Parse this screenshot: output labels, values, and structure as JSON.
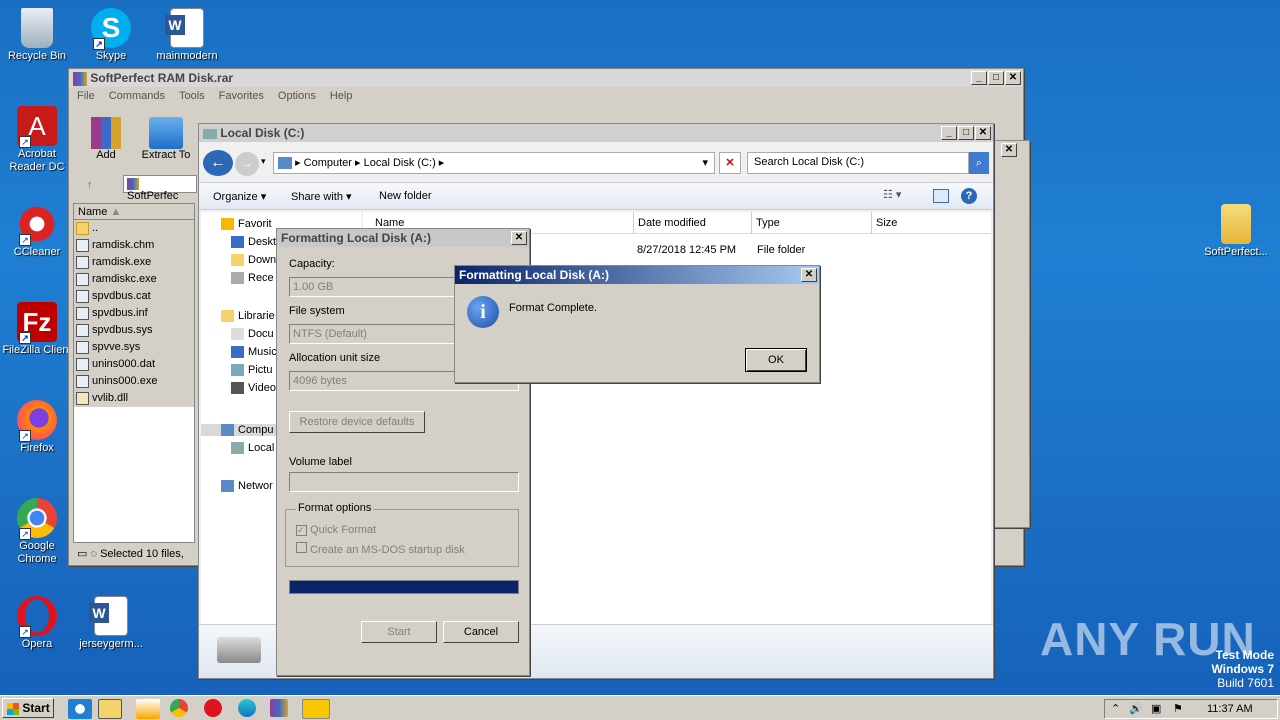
{
  "desktop": {
    "icons": [
      {
        "label": "Recycle Bin",
        "icon": "recycle-bin-icon"
      },
      {
        "label": "Skype",
        "icon": "skype-icon"
      },
      {
        "label": "mainmodern",
        "icon": "word-doc-icon"
      },
      {
        "label": "Acrobat Reader DC",
        "icon": "acrobat-icon"
      },
      {
        "label": "CCleaner",
        "icon": "ccleaner-icon"
      },
      {
        "label": "FileZilla Client",
        "icon": "filezilla-icon"
      },
      {
        "label": "Firefox",
        "icon": "firefox-icon"
      },
      {
        "label": "Google Chrome",
        "icon": "chrome-icon"
      },
      {
        "label": "Opera",
        "icon": "opera-icon"
      },
      {
        "label": "jerseygerm...",
        "icon": "word-doc-icon"
      },
      {
        "label": "SoftPerfect...",
        "icon": "folder-archive-icon"
      }
    ],
    "watermark": {
      "brand": "ANY RUN",
      "mode": "Test Mode",
      "os": "Windows 7",
      "build": "Build 7601"
    }
  },
  "winrar": {
    "title": "SoftPerfect RAM Disk.rar",
    "menu": [
      "File",
      "Commands",
      "Tools",
      "Favorites",
      "Options",
      "Help"
    ],
    "toolbar": {
      "add": "Add",
      "extract": "Extract To"
    },
    "path": "SoftPerfec",
    "column_name": "Name",
    "files": [
      "..",
      "ramdisk.chm",
      "ramdisk.exe",
      "ramdiskc.exe",
      "spvdbus.cat",
      "spvdbus.inf",
      "spvdbus.sys",
      "spvve.sys",
      "unins000.dat",
      "unins000.exe",
      "vvlib.dll"
    ],
    "status": "Selected 10 files,"
  },
  "explorer": {
    "title": "Local Disk (C:)",
    "breadcrumb": [
      "Computer",
      "Local Disk (C:)"
    ],
    "search_placeholder": "Search Local Disk (C:)",
    "commands": {
      "organize": "Organize",
      "share": "Share with",
      "newfolder": "New folder"
    },
    "nav": [
      "Favorit",
      "Deskt",
      "Down",
      "Rece",
      "Librarie",
      "Docu",
      "Music",
      "Pictu",
      "Video",
      "Compu",
      "Local",
      "Networ"
    ],
    "columns": [
      "Name",
      "Date modified",
      "Type",
      "Size"
    ],
    "rows": [
      {
        "date": "8/27/2018 12:45 PM",
        "type": "File folder"
      }
    ]
  },
  "format_dialog": {
    "title": "Formatting Local Disk (A:)",
    "capacity_label": "Capacity:",
    "capacity_value": "1.00 GB",
    "fs_label": "File system",
    "fs_value": "NTFS (Default)",
    "alloc_label": "Allocation unit size",
    "alloc_value": "4096 bytes",
    "restore": "Restore device defaults",
    "volume_label": "Volume label",
    "options_label": "Format options",
    "quick": "Quick Format",
    "msdos": "Create an MS-DOS startup disk",
    "start": "Start",
    "cancel": "Cancel",
    "progress": 1.0
  },
  "message_box": {
    "title": "Formatting Local Disk (A:)",
    "text": "Format Complete.",
    "ok": "OK"
  },
  "taskbar": {
    "start": "Start",
    "time": "11:37 AM"
  },
  "colors": {
    "titlebar_active": "#0a246a",
    "progress": "#0a246a",
    "desktop": "#1f7fd3"
  }
}
